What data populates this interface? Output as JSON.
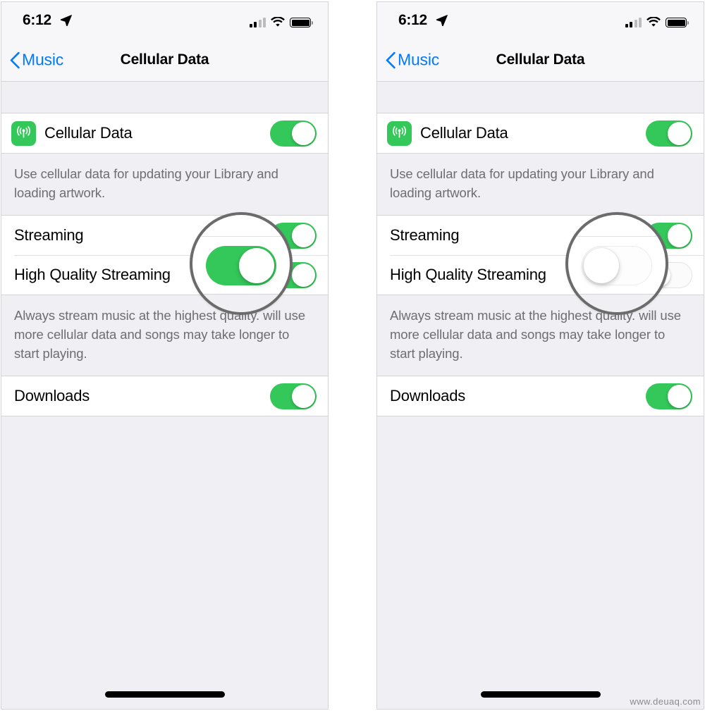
{
  "watermark": "www.deuaq.com",
  "colors": {
    "accent_blue": "#007aff",
    "toggle_green": "#34c759",
    "group_bg": "#ffffff",
    "page_bg": "#efeff4",
    "footer_text": "#6d6d72",
    "magnifier_ring": "#6b6b6b"
  },
  "panels": [
    {
      "id": "left",
      "status_bar": {
        "time": "6:12",
        "location_icon": "location-arrow-icon",
        "signal_icon": "cellular-signal-icon",
        "wifi_icon": "wifi-icon",
        "battery_icon": "battery-full-icon"
      },
      "nav": {
        "back_icon": "chevron-left-icon",
        "back_label": "Music",
        "title": "Cellular Data"
      },
      "sections": [
        {
          "rows": [
            {
              "icon": "cellular-antenna-icon",
              "label": "Cellular Data",
              "toggle": "on"
            }
          ],
          "footer": "Use cellular data for updating your Library and loading artwork."
        },
        {
          "rows": [
            {
              "icon": null,
              "label": "Streaming",
              "toggle": "on"
            },
            {
              "icon": null,
              "label": "High Quality Streaming",
              "toggle": "on"
            }
          ],
          "footer": "Always stream music at the highest quality. will use more cellular data and songs may take longer to start playing."
        },
        {
          "rows": [
            {
              "icon": null,
              "label": "Downloads",
              "toggle": "on"
            }
          ],
          "footer": ""
        }
      ],
      "magnifier": {
        "target": "High Quality Streaming",
        "toggle": "on"
      },
      "home_indicator": "home-indicator"
    },
    {
      "id": "right",
      "status_bar": {
        "time": "6:12",
        "location_icon": "location-arrow-icon",
        "signal_icon": "cellular-signal-icon",
        "wifi_icon": "wifi-icon",
        "battery_icon": "battery-full-icon"
      },
      "nav": {
        "back_icon": "chevron-left-icon",
        "back_label": "Music",
        "title": "Cellular Data"
      },
      "sections": [
        {
          "rows": [
            {
              "icon": "cellular-antenna-icon",
              "label": "Cellular Data",
              "toggle": "on"
            }
          ],
          "footer": "Use cellular data for updating your Library and loading artwork."
        },
        {
          "rows": [
            {
              "icon": null,
              "label": "Streaming",
              "toggle": "on"
            },
            {
              "icon": null,
              "label": "High Quality Streaming",
              "toggle": "off"
            }
          ],
          "footer": "Always stream music at the highest quality. will use more cellular data and songs may take longer to start playing."
        },
        {
          "rows": [
            {
              "icon": null,
              "label": "Downloads",
              "toggle": "on"
            }
          ],
          "footer": ""
        }
      ],
      "magnifier": {
        "target": "High Quality Streaming",
        "toggle": "off"
      },
      "home_indicator": "home-indicator"
    }
  ]
}
